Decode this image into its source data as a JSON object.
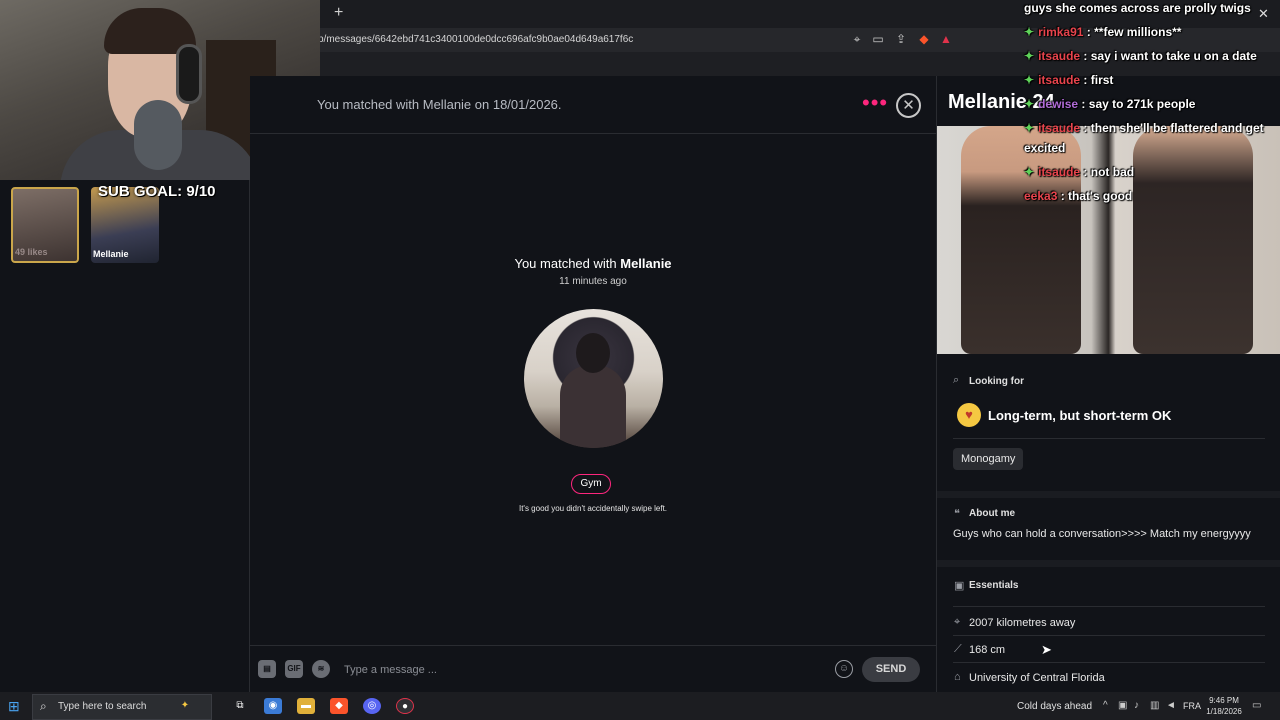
{
  "browser": {
    "url": "p/messages/6642ebd741c3400100de0dcc696afc9b0ae04d649a617f6c",
    "new_tab": "+"
  },
  "stream": {
    "sub_goal": "SUB GOAL: 9/10",
    "likes_label": "49 likes",
    "chat": [
      {
        "user": "",
        "text": "guys she comes across are prolly twigs"
      },
      {
        "user": "rimka91",
        "text": "**few millions**"
      },
      {
        "user": "itsaude",
        "text": "say i want to take u on a date"
      },
      {
        "user": "itsaude",
        "text": "first"
      },
      {
        "user": "dewise",
        "text": "say to 271k people"
      },
      {
        "user": "itsaude",
        "text": "then she'll be flattered and get"
      },
      {
        "user": "",
        "text": "excited"
      },
      {
        "user": "itsaude",
        "text": "not bad"
      },
      {
        "user": "eeka3",
        "text": "that's good"
      }
    ]
  },
  "match_list": {
    "thumb_name": "Mellanie"
  },
  "chat": {
    "header": "You matched with Mellanie on 18/01/2026.",
    "match_prefix": "You matched with",
    "match_name": "Mellanie",
    "match_time": "11 minutes ago",
    "tag": "Gym",
    "note": "It's good you didn't accidentally swipe left.",
    "placeholder": "Type a message ...",
    "send": "SEND",
    "gif": "GIF"
  },
  "profile": {
    "name": "Mellanie 24",
    "looking_for_label": "Looking for",
    "looking_for_value": "Long-term, but short-term OK",
    "monogamy": "Monogamy",
    "about_label": "About me",
    "about_text": "Guys who can hold a conversation>>>> Match my energyyyy",
    "essentials_label": "Essentials",
    "distance": "2007 kilometres away",
    "height": "168 cm",
    "school": "University of Central Florida"
  },
  "taskbar": {
    "search": "Type here to search",
    "weather": "Cold days ahead",
    "lang": "FRA",
    "time": "9:46 PM",
    "date": "1/18/2026"
  },
  "colors": {
    "accent": "#fd267d",
    "background": "#111318",
    "star": "#5fd35a"
  }
}
